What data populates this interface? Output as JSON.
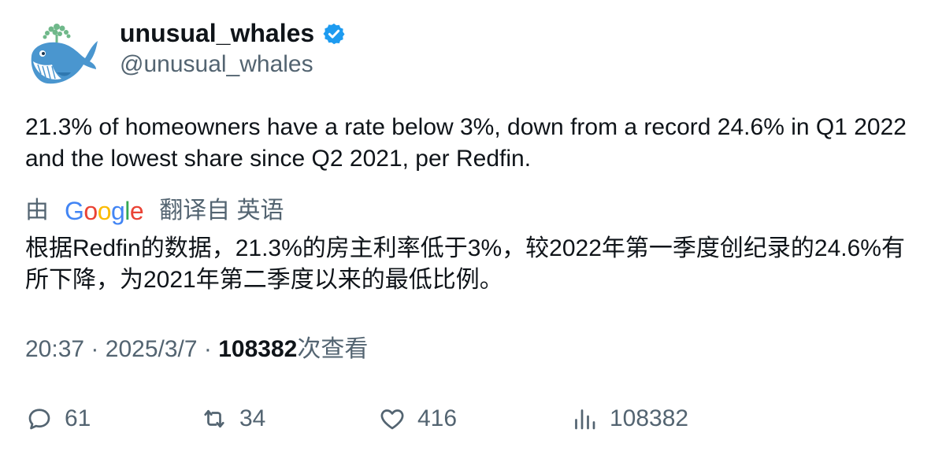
{
  "account": {
    "display_name": "unusual_whales",
    "handle": "@unusual_whales"
  },
  "tweet": {
    "text": "21.3% of homeowners have a rate below 3%, down from a record 24.6% in Q1 2022 and the lowest share since Q2 2021, per Redfin."
  },
  "translation": {
    "prefix": "由",
    "provider": "Google",
    "suffix": "翻译自 英语",
    "text": "根据Redfin的数据，21.3%的房主利率低于3%，较2022年第一季度创纪录的24.6%有所下降，为2021年第二季度以来的最低比例。"
  },
  "meta": {
    "time": "20:37",
    "separator": "·",
    "date": "2025/3/7",
    "views_count": "108382",
    "views_label": "次查看"
  },
  "actions": {
    "replies": "61",
    "retweets": "34",
    "likes": "416",
    "views": "108382"
  },
  "colors": {
    "verified_blue": "#1d9bf0",
    "secondary_text": "#536471",
    "primary_text": "#0f1419"
  }
}
